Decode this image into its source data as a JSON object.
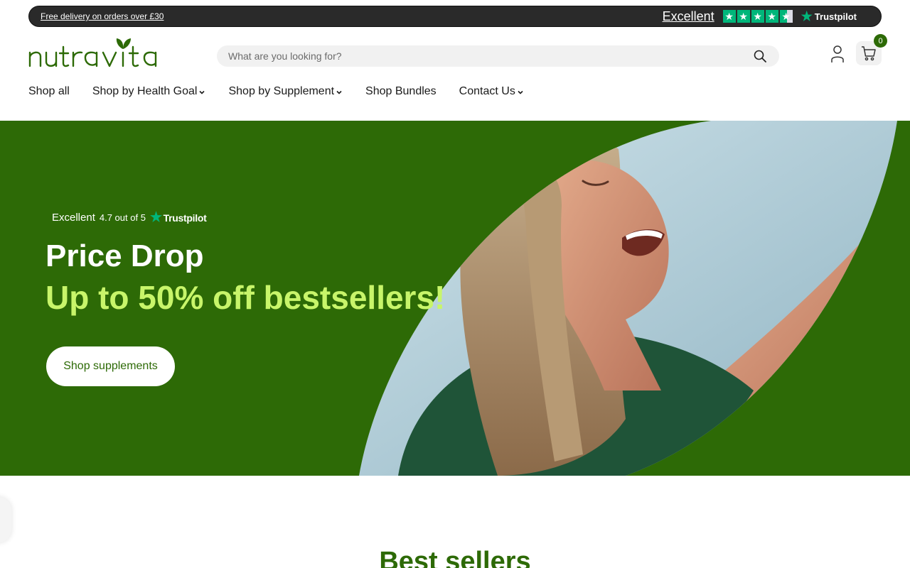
{
  "announcement": {
    "promo_text": "Free delivery on orders over £30",
    "rating_word": "Excellent",
    "stars": 4.5,
    "brand": "Trustpilot"
  },
  "header": {
    "logo_text": "nutravita",
    "search": {
      "placeholder": "What are you looking for?",
      "value": ""
    },
    "cart_count": "0"
  },
  "nav": {
    "items": [
      {
        "label": "Shop all",
        "dropdown": false
      },
      {
        "label": "Shop by Health Goal",
        "dropdown": true
      },
      {
        "label": "Shop by Supplement",
        "dropdown": true
      },
      {
        "label": "Shop Bundles",
        "dropdown": false
      },
      {
        "label": "Contact Us",
        "dropdown": true
      }
    ]
  },
  "hero": {
    "rating_word": "Excellent",
    "rating_score": "4.7 out of 5",
    "rating_brand": "Trustpilot",
    "title": "Price Drop",
    "subtitle": "Up to 50% off bestsellers!",
    "cta_label": "Shop supplements"
  },
  "sections": {
    "best_sellers_title": "Best sellers"
  },
  "colors": {
    "brand_green": "#2d6a06",
    "accent_lime": "#c8f56a",
    "trustpilot_green": "#00b67a",
    "announcement_bg": "#2a2a2a"
  },
  "icons": {
    "search": "search-icon",
    "account": "user-icon",
    "cart": "cart-icon",
    "dropdown": "chevron-down-icon",
    "trustpilot": "trustpilot-star-icon"
  }
}
